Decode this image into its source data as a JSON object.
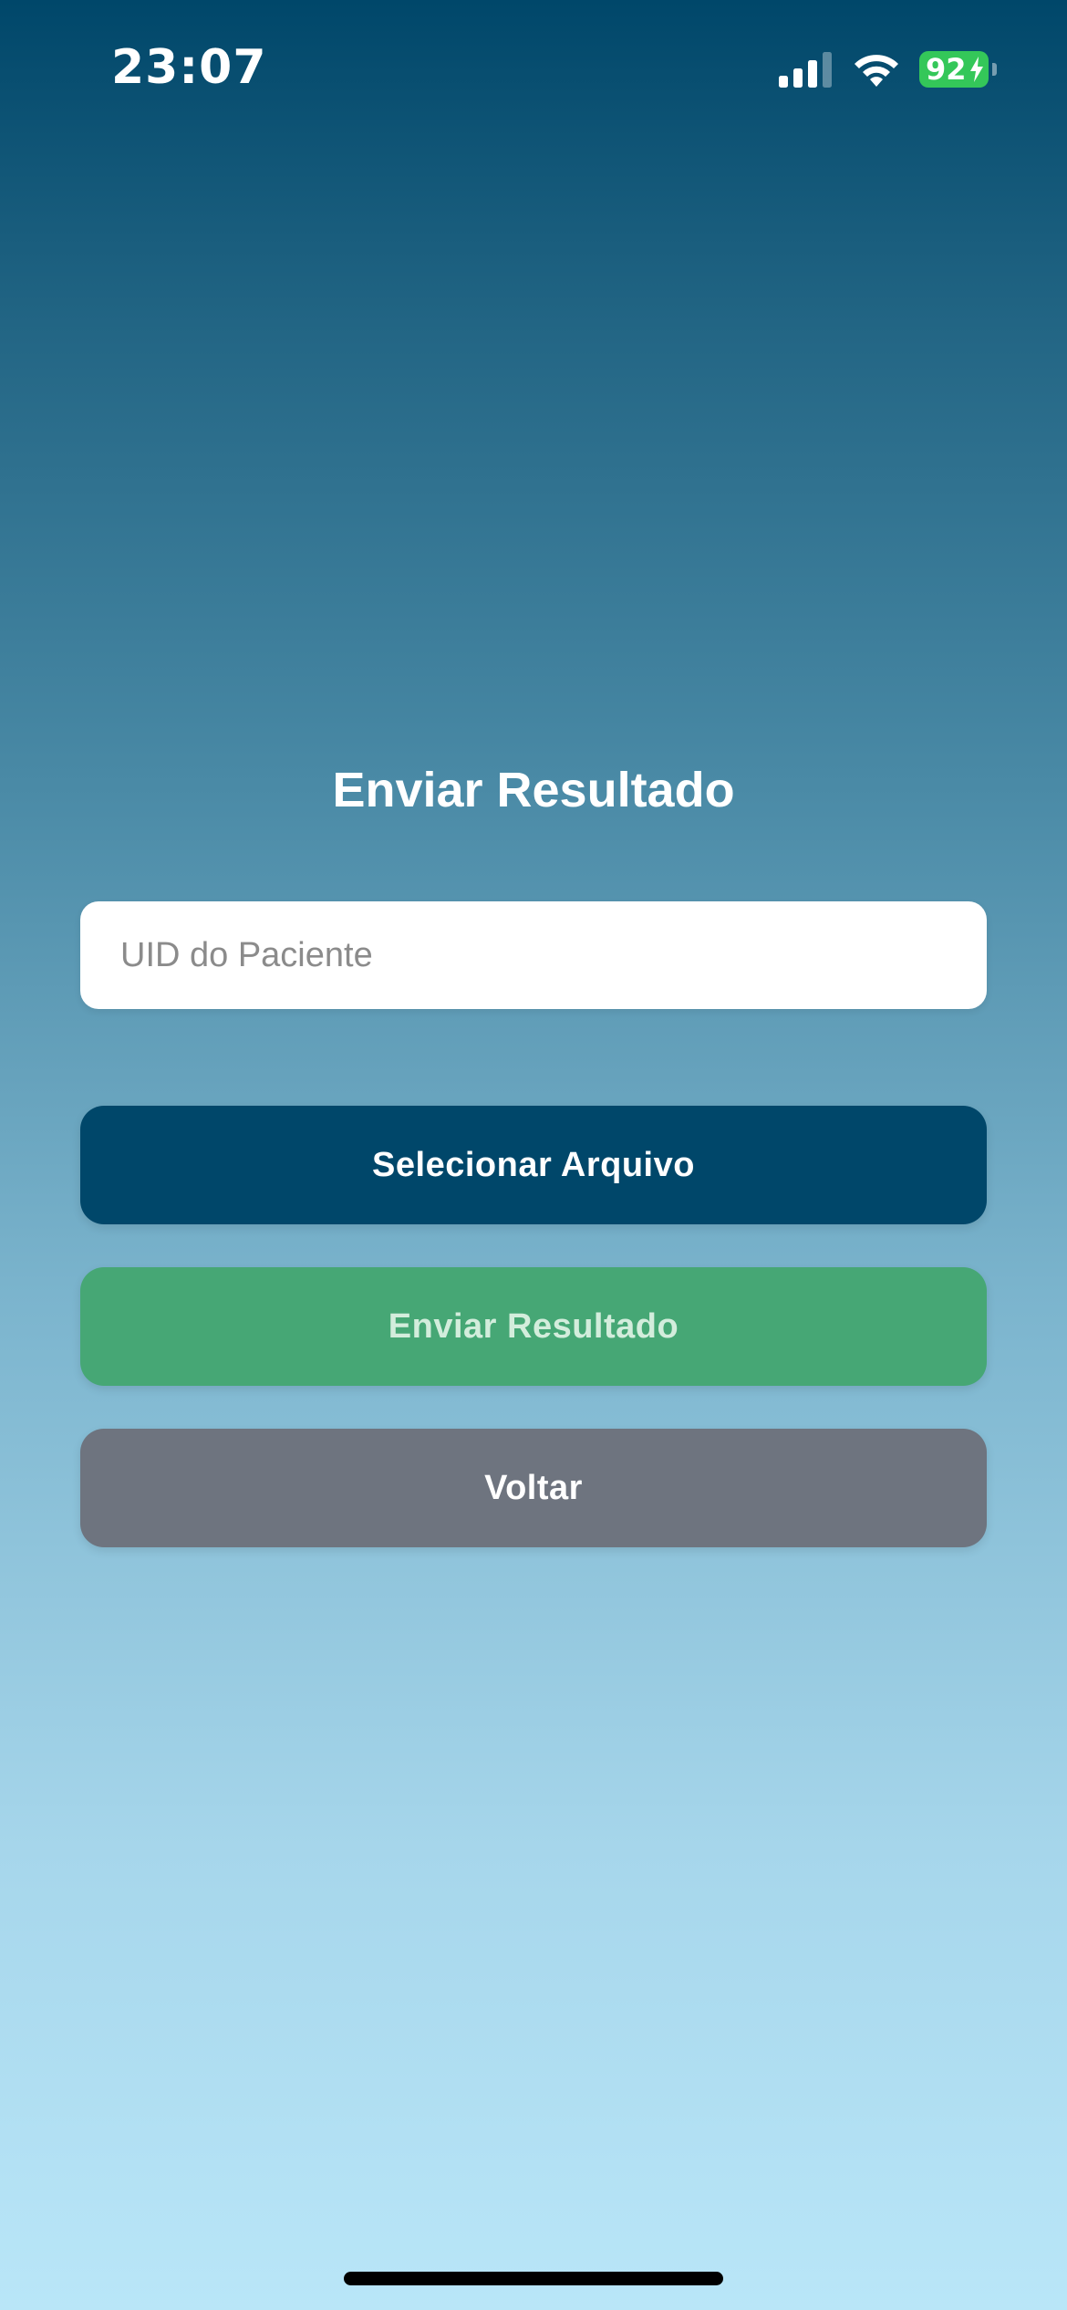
{
  "status_bar": {
    "time": "23:07",
    "battery_percent": "92",
    "signal_icon": "cellular-signal-icon",
    "wifi_icon": "wifi-icon",
    "battery_icon": "battery-charging-icon",
    "battery_color": "#34c759"
  },
  "screen": {
    "title": "Enviar Resultado",
    "uid_input": {
      "value": "",
      "placeholder": "UID do Paciente"
    },
    "buttons": {
      "select_file": "Selecionar Arquivo",
      "send_result": "Enviar Resultado",
      "back": "Voltar"
    }
  },
  "colors": {
    "gradient_top": "#00476a",
    "gradient_bottom": "#b9e6f8",
    "select_button": "#00476a",
    "send_button": "#46a775",
    "back_button": "#6e747f"
  }
}
